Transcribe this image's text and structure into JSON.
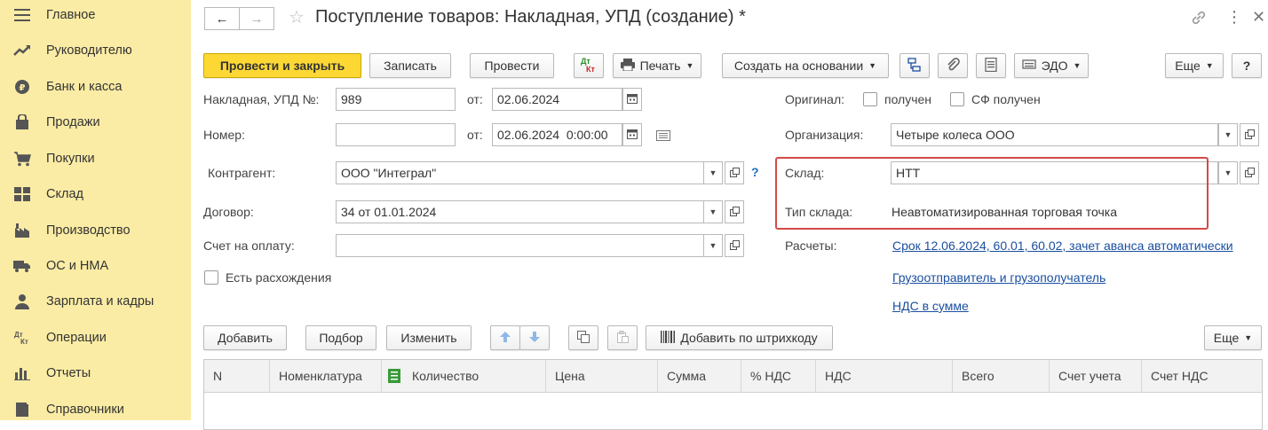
{
  "sidebar": {
    "items": [
      {
        "label": "Главное",
        "icon": "menu-icon"
      },
      {
        "label": "Руководителю",
        "icon": "trend-icon"
      },
      {
        "label": "Банк и касса",
        "icon": "coin-icon"
      },
      {
        "label": "Продажи",
        "icon": "bag-icon"
      },
      {
        "label": "Покупки",
        "icon": "cart-icon"
      },
      {
        "label": "Склад",
        "icon": "warehouse-icon"
      },
      {
        "label": "Производство",
        "icon": "factory-icon"
      },
      {
        "label": "ОС и НМА",
        "icon": "truck-icon"
      },
      {
        "label": "Зарплата и кадры",
        "icon": "person-icon"
      },
      {
        "label": "Операции",
        "icon": "dt-kt-icon"
      },
      {
        "label": "Отчеты",
        "icon": "bar-chart-icon"
      },
      {
        "label": "Справочники",
        "icon": "book-icon"
      }
    ],
    "dt_text": "Дт",
    "kt_text": "Кт"
  },
  "header": {
    "title": "Поступление товаров: Накладная, УПД (создание) *"
  },
  "toolbar": {
    "post_close": "Провести и закрыть",
    "save": "Записать",
    "post": "Провести",
    "dt": "Дт",
    "kt": "Кт",
    "print": "Печать",
    "create_based": "Создать на основании",
    "edo": "ЭДО",
    "more": "Еще",
    "help": "?"
  },
  "form": {
    "invoice_label": "Накладная, УПД №:",
    "invoice_value": "989",
    "from_label": "от:",
    "invoice_date": "02.06.2024",
    "number_label": "Номер:",
    "number_value": "",
    "from_label2": "от:",
    "doc_datetime": "02.06.2024  0:00:00",
    "contractor_label": "Контрагент:",
    "contractor_value": "ООО \"Интеграл\"",
    "contractor_help": "?",
    "contract_label": "Договор:",
    "contract_value": "34 от 01.01.2024",
    "invoice_pay_label": "Счет на оплату:",
    "invoice_pay_value": "",
    "discrepancy_label": "Есть расхождения",
    "original_label": "Оригинал:",
    "received_label": "получен",
    "sf_received_label": "СФ получен",
    "org_label": "Организация:",
    "org_value": "Четыре колеса ООО",
    "warehouse_label": "Склад:",
    "warehouse_value": "НТТ",
    "wh_type_label": "Тип склада:",
    "wh_type_value": "Неавтоматизированная торговая точка",
    "settlements_label": "Расчеты:",
    "settlements_link": "Срок 12.06.2024, 60.01, 60.02, зачет аванса автоматически",
    "shipper_link": "Грузоотправитель и грузополучатель",
    "vat_link": "НДС в сумме"
  },
  "table_toolbar": {
    "add": "Добавить",
    "pick": "Подбор",
    "edit": "Изменить",
    "barcode": "Добавить по штрихкоду",
    "more": "Еще"
  },
  "table": {
    "columns": [
      "N",
      "Номенклатура",
      "Количество",
      "Цена",
      "Сумма",
      "% НДС",
      "НДС",
      "Всего",
      "Счет учета",
      "Счет НДС"
    ]
  },
  "colors": {
    "sidebar_bg": "#fbeca5",
    "primary_button": "#fdd835",
    "link": "#1b4fa0",
    "highlight_frame": "#d34a4a"
  }
}
